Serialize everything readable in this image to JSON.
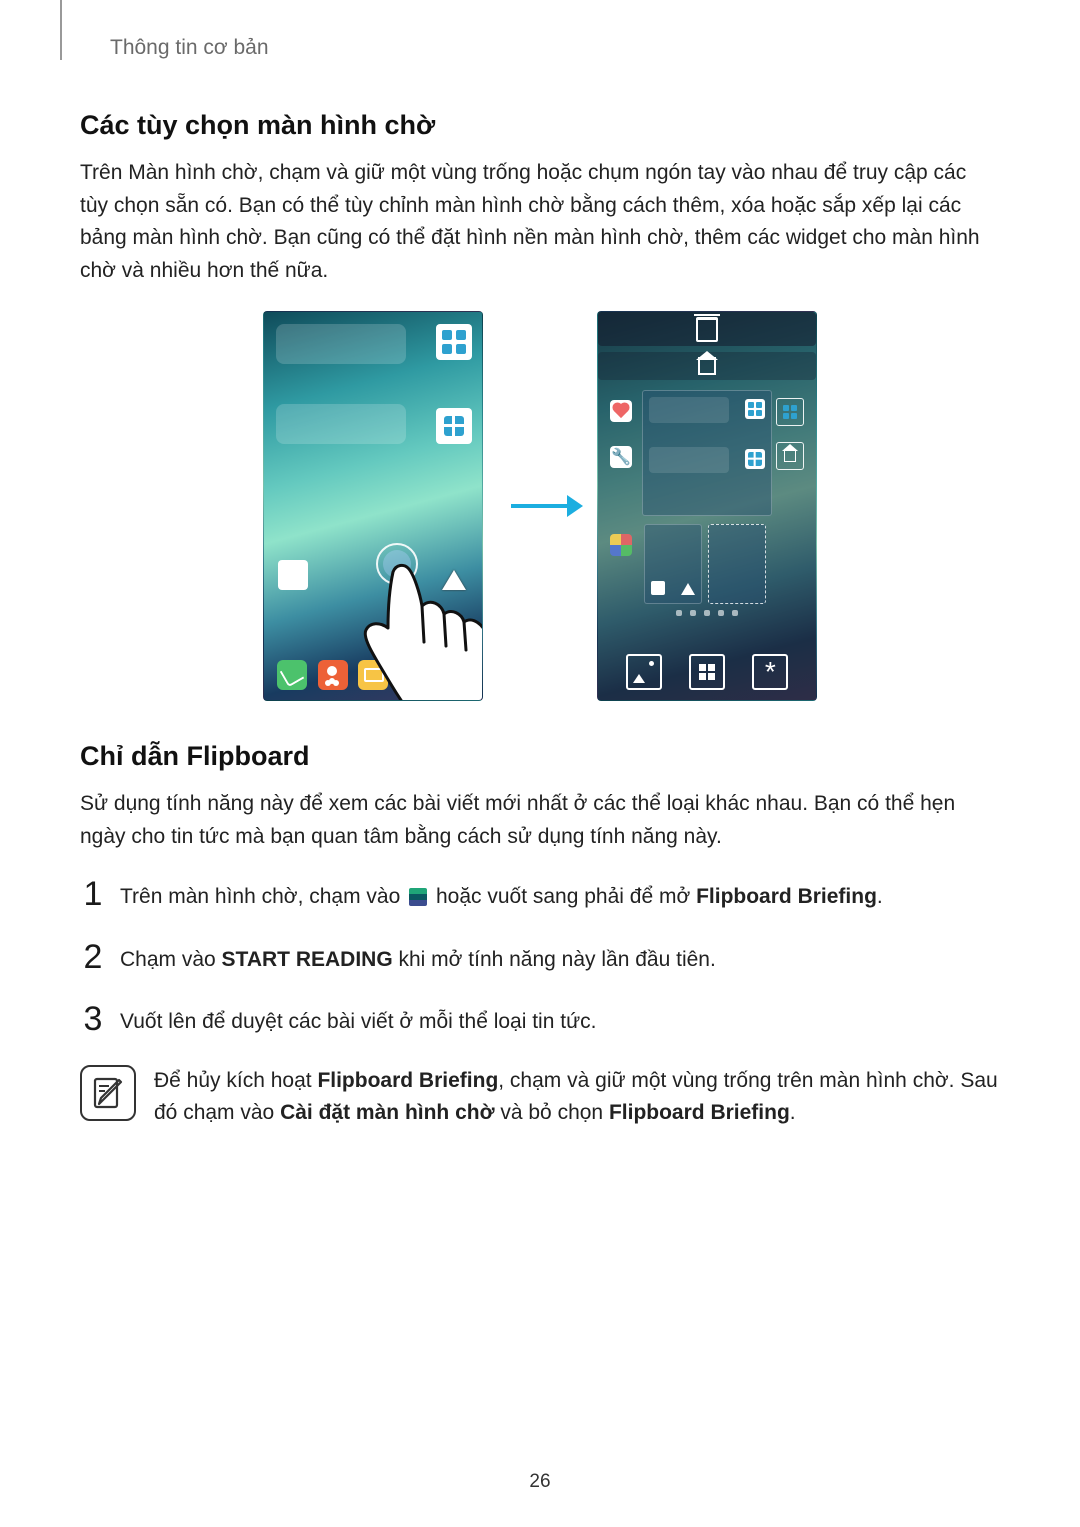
{
  "breadcrumb": "Thông tin cơ bản",
  "section1": {
    "title": "Các tùy chọn màn hình chờ",
    "body": "Trên Màn hình chờ, chạm và giữ một vùng trống hoặc chụm ngón tay vào nhau để truy cập các tùy chọn sẵn có. Bạn có thể tùy chỉnh màn hình chờ bằng cách thêm, xóa hoặc sắp xếp lại các bảng màn hình chờ. Bạn cũng có thể đặt hình nền màn hình chờ, thêm các widget cho màn hình chờ và nhiều hơn thế nữa."
  },
  "figure": {
    "phone_before_alt": "Màn hình chờ đang được chạm và giữ",
    "phone_after_alt": "Màn hình tuỳ chọn màn hình chờ",
    "arrow_alt": "mũi tên sang phải",
    "opt_wallpapers_alt": "Hình nền",
    "opt_widgets_alt": "Widget",
    "opt_settings_alt": "Cài đặt màn hình chờ",
    "trash_alt": "Xoá",
    "home_alt": "Trang chính"
  },
  "section2": {
    "title": "Chỉ dẫn Flipboard",
    "body": "Sử dụng tính năng này để xem các bài viết mới nhất ở các thể loại khác nhau. Bạn có thể hẹn ngày cho tin tức mà bạn quan tâm bằng cách sử dụng tính năng này."
  },
  "steps": {
    "s1": {
      "num": "1",
      "pre": "Trên màn hình chờ, chạm vào ",
      "post": " hoặc vuốt sang phải để mở ",
      "bold": "Flipboard Briefing",
      "tail": "."
    },
    "s2": {
      "num": "2",
      "pre": "Chạm vào ",
      "bold": "START READING",
      "post": " khi mở tính năng này lần đầu tiên."
    },
    "s3": {
      "num": "3",
      "text": "Vuốt lên để duyệt các bài viết ở mỗi thể loại tin tức."
    }
  },
  "note": {
    "pre": "Để hủy kích hoạt ",
    "b1": "Flipboard Briefing",
    "mid": ", chạm và giữ một vùng trống trên màn hình chờ. Sau đó chạm vào ",
    "b2": "Cài đặt màn hình chờ",
    "mid2": " và bỏ chọn ",
    "b3": "Flipboard Briefing",
    "tail": "."
  },
  "page_number": "26"
}
